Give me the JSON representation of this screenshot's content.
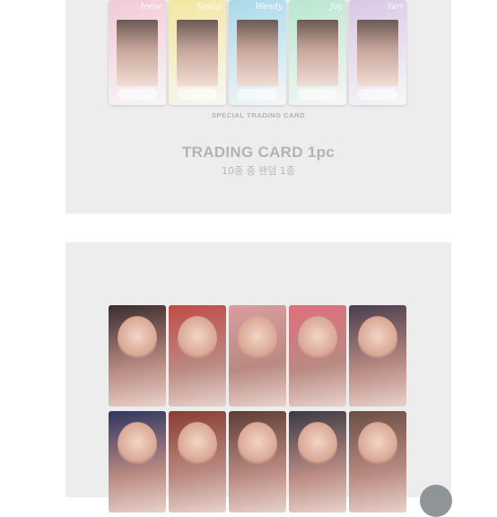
{
  "special": {
    "cards": [
      {
        "name": "Irene",
        "bg": "#f2c9d6"
      },
      {
        "name": "Seulgi",
        "bg": "#f3e6a0"
      },
      {
        "name": "Wendy",
        "bg": "#a9d8ea"
      },
      {
        "name": "Joy",
        "bg": "#b9e6cf"
      },
      {
        "name": "Yeri",
        "bg": "#d9c7e6"
      }
    ],
    "caption": "SPECIAL TRADING CARD"
  },
  "trading_card": {
    "title": "TRADING CARD 1pc",
    "subtitle": "10종 중 랜덤 1종"
  },
  "photocards": {
    "row1": [
      "#3a2d2e",
      "#c34b47",
      "#d89d9e",
      "#e06f7d",
      "#4a3e4f"
    ],
    "row2": [
      "#2f3560",
      "#8b3b32",
      "#5e3c35",
      "#3b3a44",
      "#6a4e45"
    ]
  }
}
